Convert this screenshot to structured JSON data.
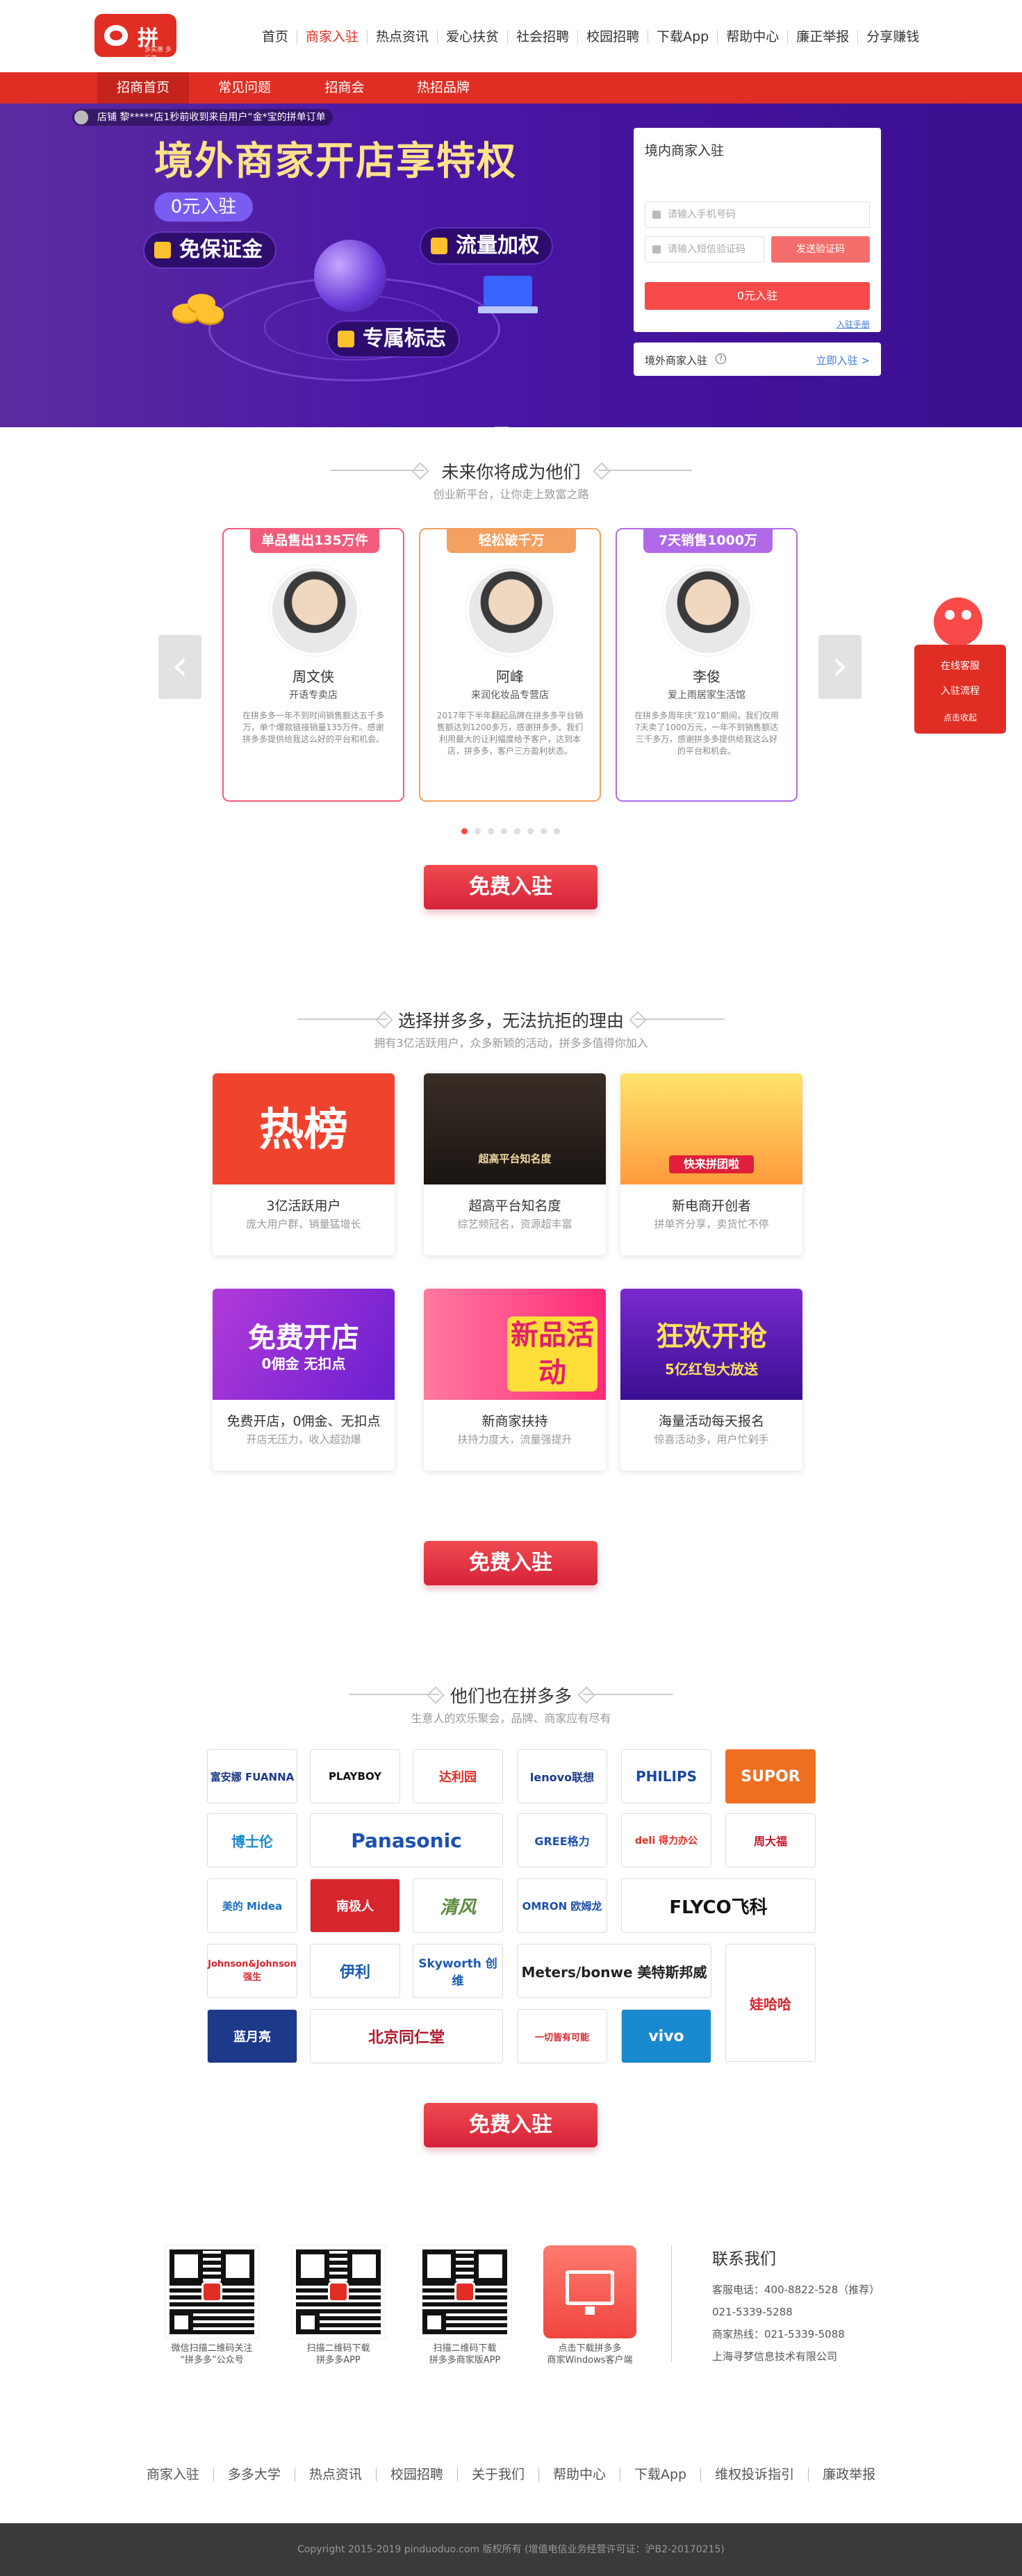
{
  "header": {
    "logo_text": "拼多多",
    "logo_sub": "多实惠 多乐趣",
    "nav": [
      "首页",
      "商家入驻",
      "热点资讯",
      "爱心扶贫",
      "社会招聘",
      "校园招聘",
      "下载App",
      "帮助中心",
      "廉正举报",
      "分享赚钱"
    ],
    "active_nav": "商家入驻"
  },
  "subnav": {
    "tabs": [
      "招商首页",
      "常见问题",
      "招商会",
      "热招品牌"
    ],
    "active": "招商首页"
  },
  "hero": {
    "ticker": "店铺 黎*****店1秒前收到来自用户“金*宝的拼单订单",
    "title": "境外商家开店享特权",
    "pill": "0元入驻",
    "tags": [
      "免保证金",
      "流量加权",
      "专属标志"
    ]
  },
  "signup": {
    "title": "境内商家入驻",
    "phone_placeholder": "请输入手机号码",
    "code_placeholder": "请输入短信验证码",
    "sms_button": "发送验证码",
    "submit": "0元入驻",
    "guide_link": "入驻手册",
    "overseas_label": "境外商家入驻",
    "overseas_help": "?",
    "overseas_link": "立即入驻 >"
  },
  "section1": {
    "title": "未来你将成为他们",
    "subtitle": "创业新平台，让你走上致富之路"
  },
  "merchants": [
    {
      "ribbon": "单品售出135万件",
      "name": "周文侠",
      "role": "开语专卖店",
      "desc": "在拼多多一年不到时间销售额达五千多万，单个爆款链接销量135万件。感谢拼多多提供给我这么好的平台和机会。",
      "color": "#f25c7c"
    },
    {
      "ribbon": "轻松破千万",
      "name": "阿峰",
      "role": "来润化妆品专营店",
      "desc": "2017年下半年翻起品牌在拼多多平台销售额达到1200多万，感谢拼多多。我们利用最大的让利幅度给予客户，达到本店，拼多多，客户三方盈利状态。",
      "color": "#f4a060"
    },
    {
      "ribbon": "7天销售1000万",
      "name": "李俊",
      "role": "爱上雨居家生活馆",
      "desc": "在拼多多周年庆“双10”期间，我们仅用7天卖了1000万元，一年不到销售额达三千多万，感谢拼多多提供给我这么好的平台和机会。",
      "color": "#b06ae8"
    }
  ],
  "carousel_dots": 8,
  "cta_label": "免费入驻",
  "section2": {
    "title": "选择拼多多，无法抗拒的理由",
    "subtitle": "拥有3亿活跃用户，众多新颖的活动，拼多多值得你加入"
  },
  "features": [
    {
      "img_text": "热榜",
      "title": "3亿活跃用户",
      "sub": "庞大用户群，销量猛增长",
      "bg": "#f0432e"
    },
    {
      "img_text": "超高平台知名度",
      "title": "超高平台知名度",
      "sub": "综艺频冠名，资源超丰富",
      "bg": "#2a2420"
    },
    {
      "img_text": "快来拼团啦",
      "title": "新电商开创者",
      "sub": "拼单齐分享，卖货忙不停",
      "bg": "#ffcf3c"
    },
    {
      "img_text": "免费开店",
      "img_sub": "0佣金  无扣点",
      "title": "免费开店，0佣金、无扣点",
      "sub": "开店无压力，收入超劲爆",
      "bg": "#8a2ad6"
    },
    {
      "img_text": "新品活动",
      "title": "新商家扶持",
      "sub": "扶持力度大，流量强提升",
      "bg": "#ff3f8e"
    },
    {
      "img_text": "狂欢开抢",
      "img_sub": "5亿红包大放送",
      "title": "海量活动每天报名",
      "sub": "惊喜活动多，用户忙剁手",
      "bg": "#5a1fb0"
    }
  ],
  "section3": {
    "title": "他们也在拼多多",
    "subtitle": "生意人的欢乐聚会，品牌、商家应有尽有"
  },
  "brands": [
    "富安娜 FUANNA",
    "PLAYBOY",
    "达利园",
    "lenovo联想",
    "PHILIPS",
    "SUPOR",
    "博士伦",
    "Panasonic",
    "GREE格力",
    "deli 得力办公",
    "周大福",
    "美的 Midea",
    "南极人",
    "清风",
    "OMRON 欧姆龙",
    "FLYCO飞科",
    "Johnson&Johnson 强生",
    "伊利",
    "Skyworth 创维",
    "Meters/bonwe 美特斯邦威",
    "娃哈哈",
    "蓝月亮",
    "北京同仁堂",
    "一切皆有可能",
    "vivo"
  ],
  "float": {
    "items": [
      "在线客服",
      "入驻流程",
      "点击收起"
    ]
  },
  "footer": {
    "qr": [
      {
        "caption": "微信扫描二维码关注\n“拼多多”公众号"
      },
      {
        "caption": "扫描二维码下载\n拼多多APP"
      },
      {
        "caption": "扫描二维码下载\n拼多多商家版APP"
      },
      {
        "caption": "点击下载拼多多\n商家Windows客户端"
      }
    ],
    "contact_title": "联系我们",
    "contact_lines": [
      "客服电话：400-8822-528（推荐）",
      "021-5339-5288",
      "商家热线：021-5339-5088",
      "上海寻梦信息技术有限公司"
    ],
    "nav": [
      "商家入驻",
      "多多大学",
      "热点资讯",
      "校园招聘",
      "关于我们",
      "帮助中心",
      "下载App",
      "维权投诉指引",
      "廉政举报"
    ],
    "copyright": "Copyright 2015-2019 pinduoduo.com 版权所有 (增值电信业务经营许可证：沪B2-20170215)"
  }
}
